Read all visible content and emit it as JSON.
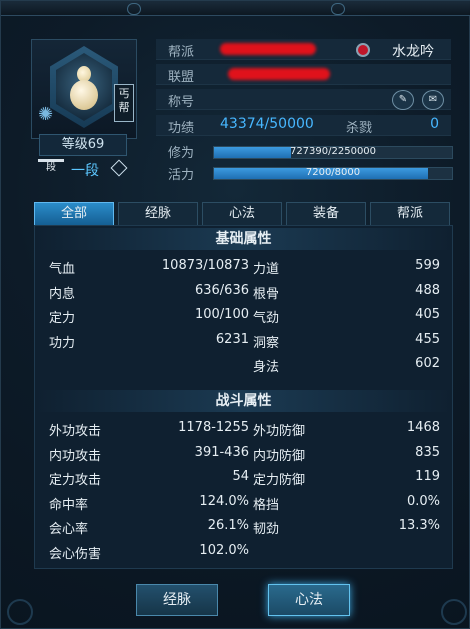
{
  "profile": {
    "level": "等级69",
    "sect_badge": "丐帮",
    "rank_icon_text": "段",
    "rank": "一段",
    "fame_name": "水龙吟"
  },
  "info": {
    "guild_label": "帮派",
    "alliance_label": "联盟",
    "title_label": "称号",
    "merit_label": "功绩",
    "merit_value": "43374/50000",
    "kills_label": "杀戮",
    "kills_value": "0",
    "cultivation_label": "修为",
    "cultivation_value": "727390/2250000",
    "cultivation_fraction": 0.323,
    "vitality_label": "活力",
    "vitality_value": "7200/8000",
    "vitality_fraction": 0.9
  },
  "tabs": [
    "全部",
    "经脉",
    "心法",
    "装备",
    "帮派"
  ],
  "basic": {
    "header": "基础属性",
    "left": [
      {
        "k": "气血",
        "v": "10873/10873"
      },
      {
        "k": "内息",
        "v": "636/636"
      },
      {
        "k": "定力",
        "v": "100/100"
      },
      {
        "k": "功力",
        "v": "6231"
      }
    ],
    "right": [
      {
        "k": "力道",
        "v": "599"
      },
      {
        "k": "根骨",
        "v": "488"
      },
      {
        "k": "气劲",
        "v": "405"
      },
      {
        "k": "洞察",
        "v": "455"
      },
      {
        "k": "身法",
        "v": "602"
      }
    ]
  },
  "combat": {
    "header": "战斗属性",
    "left": [
      {
        "k": "外功攻击",
        "v": "1178-1255"
      },
      {
        "k": "内功攻击",
        "v": "391-436"
      },
      {
        "k": "定力攻击",
        "v": "54"
      },
      {
        "k": "命中率",
        "v": "124.0%"
      },
      {
        "k": "会心率",
        "v": "26.1%"
      },
      {
        "k": "会心伤害",
        "v": "102.0%"
      }
    ],
    "right": [
      {
        "k": "外功防御",
        "v": "1468"
      },
      {
        "k": "内功防御",
        "v": "835"
      },
      {
        "k": "定力防御",
        "v": "119"
      },
      {
        "k": "格挡",
        "v": "0.0%"
      },
      {
        "k": "韧劲",
        "v": "13.3%"
      }
    ]
  },
  "buttons": {
    "meridian": "经脉",
    "mind_method": "心法"
  },
  "colors": {
    "accent": "#47b7ff",
    "tab_active": "#2b8cc9",
    "redaction": "#e0121b"
  }
}
